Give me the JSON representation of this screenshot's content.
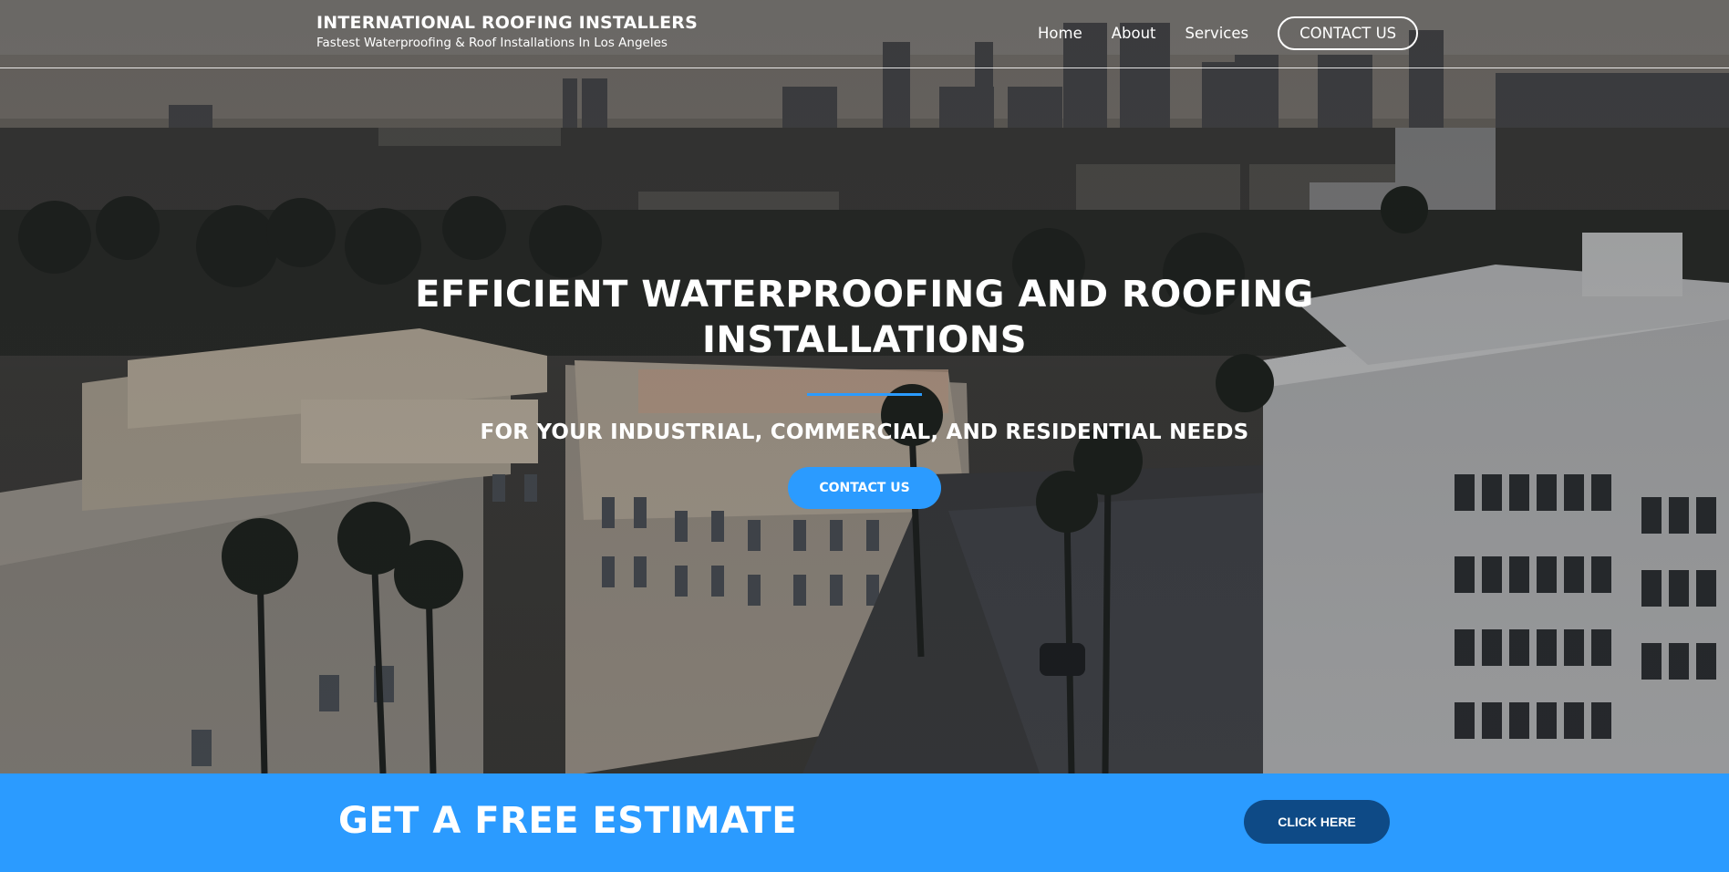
{
  "header": {
    "brand_title": "INTERNATIONAL ROOFING INSTALLERS",
    "brand_subtitle": "Fastest Waterproofing & Roof Installations In Los Angeles",
    "nav": [
      {
        "label": "Home"
      },
      {
        "label": "About"
      },
      {
        "label": "Services"
      }
    ],
    "contact_label": "CONTACT US"
  },
  "hero": {
    "title": "EFFICIENT WATERPROOFING AND ROOFING INSTALLATIONS",
    "subtitle": "FOR YOUR INDUSTRIAL, COMMERCIAL, AND RESIDENTIAL NEEDS",
    "cta_label": "CONTACT US",
    "background_image": "aerial-city-skyline"
  },
  "estimate": {
    "title": "GET A FREE ESTIMATE",
    "button_label": "CLICK HERE"
  },
  "colors": {
    "accent": "#2b9bff",
    "accent_dark": "#0e4a86",
    "text_light": "#ffffff"
  }
}
